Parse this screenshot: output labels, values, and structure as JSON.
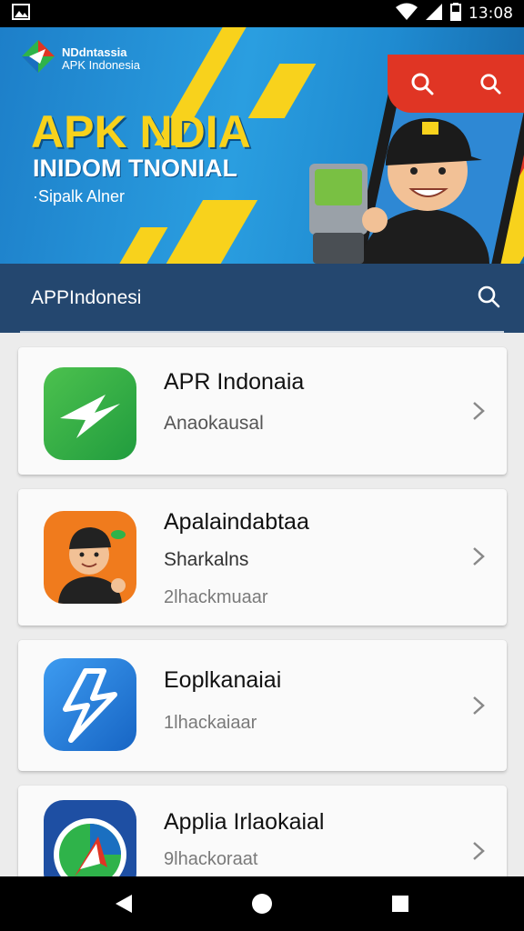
{
  "status_bar": {
    "time": "13:08",
    "icons": [
      "image-icon",
      "wifi-icon",
      "signal-icon",
      "battery-icon"
    ]
  },
  "banner": {
    "logo_title": "NDdntassia",
    "logo_subtitle": "APK Indonesia",
    "headline": "APK NDIA",
    "subheadline": "INIDOM TNONIAL",
    "tagline": "·Sipalk Alner",
    "actions": [
      "search-icon",
      "search-icon"
    ],
    "colors": {
      "accent": "#f8d21c",
      "action_bg": "#e03524",
      "banner_bg": "#2a9ee0"
    }
  },
  "search": {
    "placeholder": "APPIndonesi",
    "bar_color": "#24476f"
  },
  "apps": [
    {
      "title": "APR Indonaia",
      "line2": "Anaokausal",
      "line3": "",
      "icon": "app-arrow-green-icon"
    },
    {
      "title": "Apalaindabtaa",
      "line2": "Sharkalns",
      "line3": "2lhackmuaar",
      "icon": "app-mascot-icon"
    },
    {
      "title": "Eoplkanaiai",
      "line2": "1lhackaiaar",
      "line3": "",
      "icon": "app-lightning-blue-icon"
    },
    {
      "title": "Applia Irlaokaial",
      "line2": "9lhackoraat",
      "line3": "",
      "icon": "app-compass-icon"
    }
  ],
  "nav": [
    "back-icon",
    "home-icon",
    "recents-icon"
  ]
}
